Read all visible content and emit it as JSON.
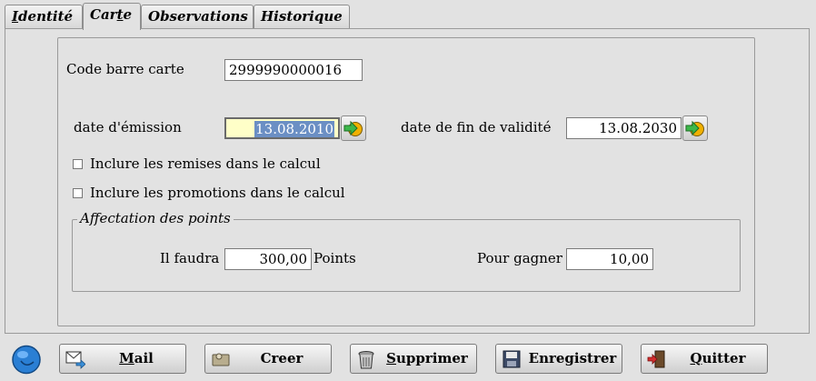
{
  "tabs": [
    {
      "label": "Identité",
      "accel": "I",
      "rest": "dentité"
    },
    {
      "label": "Carte",
      "pre": "Car",
      "accel": "t",
      "rest": "e"
    },
    {
      "label": "Observations"
    },
    {
      "label": "Historique"
    }
  ],
  "card": {
    "barcode_label": "Code barre carte",
    "barcode_value": "2999990000016",
    "issue_label": "date d'émission",
    "issue_value": "13.08.2010",
    "expiry_label": "date de fin de validité",
    "expiry_value": "13.08.2030",
    "include_discounts_label": "Inclure les remises dans le calcul",
    "include_discounts_checked": false,
    "include_promotions_label": "Inclure les promotions dans le calcul",
    "include_promotions_checked": false
  },
  "points": {
    "legend": "Affectation des points",
    "need_label": "Il faudra",
    "need_value": "300,00",
    "need_unit": "Points",
    "earn_label": "Pour gagner",
    "earn_value": "10,00"
  },
  "buttons": {
    "mail": {
      "accel": "M",
      "rest": "ail"
    },
    "create": "Creer",
    "delete": {
      "accel": "S",
      "rest": "upprimer"
    },
    "save": "Enregistrer",
    "quit": {
      "accel": "Q",
      "rest": "uitter"
    }
  },
  "colors": {
    "selection": "#6b8fc4",
    "focused_field": "#ffffc8",
    "help_button": "#2a7fd4"
  }
}
